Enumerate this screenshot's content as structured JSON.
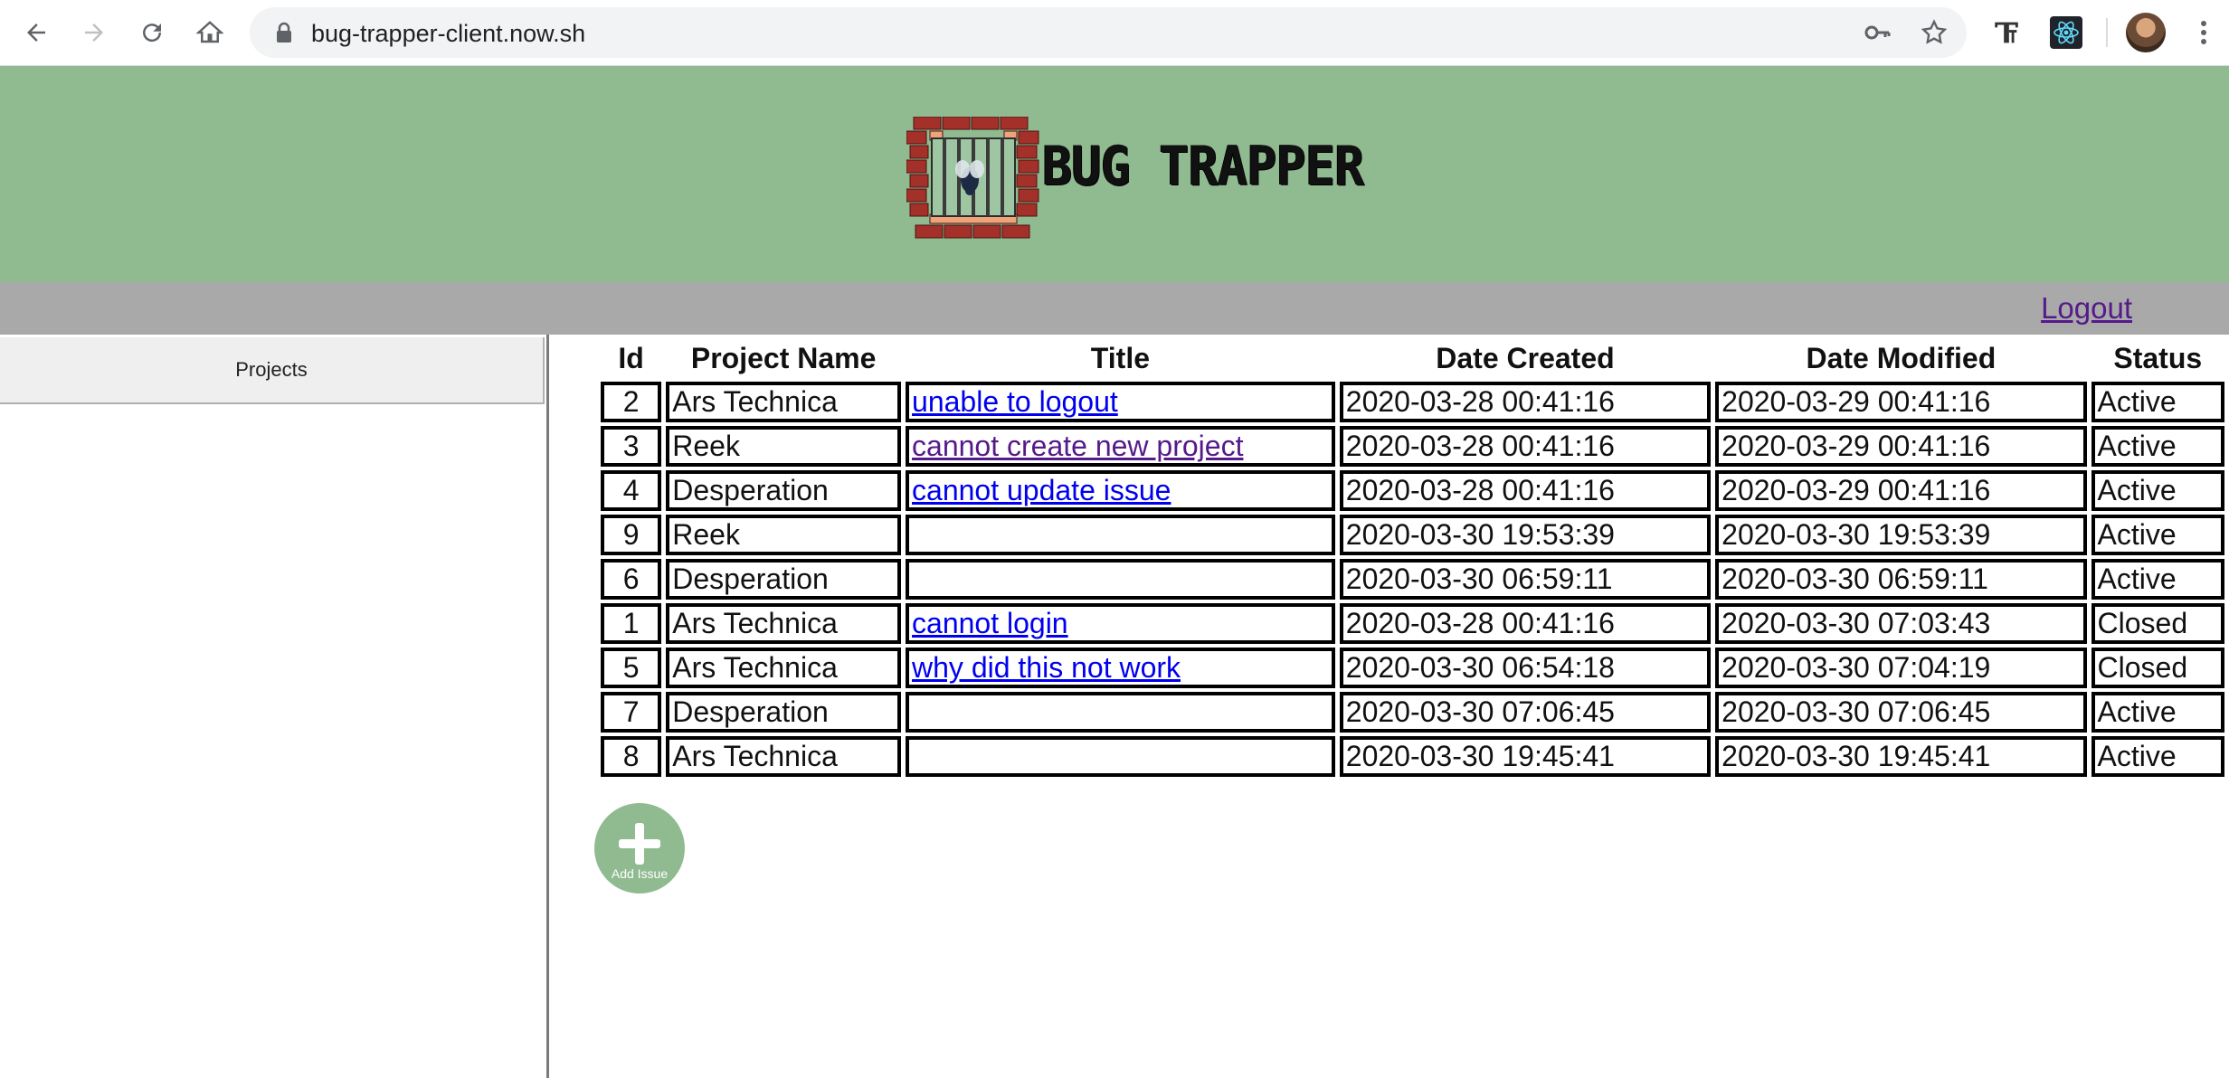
{
  "browser": {
    "url": "bug-trapper-client.now.sh"
  },
  "header": {
    "brand": "BUG TRAPPER"
  },
  "toolbar": {
    "logout_label": "Logout"
  },
  "sidebar": {
    "tab_label": "Projects"
  },
  "table": {
    "columns": [
      "Id",
      "Project Name",
      "Title",
      "Date Created",
      "Date Modified",
      "Status"
    ],
    "rows": [
      {
        "id": "2",
        "project": "Ars Technica",
        "title": "unable to logout",
        "created": "2020-03-28 00:41:16",
        "modified": "2020-03-29 00:41:16",
        "status": "Active"
      },
      {
        "id": "3",
        "project": "Reek",
        "title": "cannot create new project",
        "created": "2020-03-28 00:41:16",
        "modified": "2020-03-29 00:41:16",
        "status": "Active"
      },
      {
        "id": "4",
        "project": "Desperation",
        "title": "cannot update issue",
        "created": "2020-03-28 00:41:16",
        "modified": "2020-03-29 00:41:16",
        "status": "Active"
      },
      {
        "id": "9",
        "project": "Reek",
        "title": "",
        "created": "2020-03-30 19:53:39",
        "modified": "2020-03-30 19:53:39",
        "status": "Active"
      },
      {
        "id": "6",
        "project": "Desperation",
        "title": "",
        "created": "2020-03-30 06:59:11",
        "modified": "2020-03-30 06:59:11",
        "status": "Active"
      },
      {
        "id": "1",
        "project": "Ars Technica",
        "title": "cannot login",
        "created": "2020-03-28 00:41:16",
        "modified": "2020-03-30 07:03:43",
        "status": "Closed"
      },
      {
        "id": "5",
        "project": "Ars Technica",
        "title": "why did this not work",
        "created": "2020-03-30 06:54:18",
        "modified": "2020-03-30 07:04:19",
        "status": "Closed"
      },
      {
        "id": "7",
        "project": "Desperation",
        "title": "",
        "created": "2020-03-30 07:06:45",
        "modified": "2020-03-30 07:06:45",
        "status": "Active"
      },
      {
        "id": "8",
        "project": "Ars Technica",
        "title": "",
        "created": "2020-03-30 19:45:41",
        "modified": "2020-03-30 19:45:41",
        "status": "Active"
      }
    ]
  },
  "add_issue": {
    "label": "Add Issue"
  },
  "colors": {
    "banner": "#90bb91",
    "toolbar": "#a9a9a9",
    "link": "#0000ee",
    "visited_link": "#551a8b"
  }
}
